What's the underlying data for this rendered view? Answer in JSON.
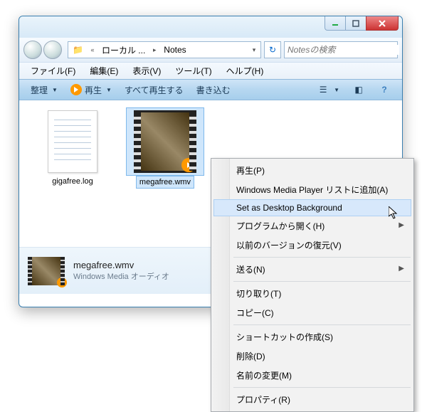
{
  "address": {
    "folder1": "ローカル ...",
    "folder2": "Notes"
  },
  "search": {
    "placeholder": "Notesの検索"
  },
  "menubar": {
    "file": "ファイル(F)",
    "edit": "編集(E)",
    "view": "表示(V)",
    "tools": "ツール(T)",
    "help": "ヘルプ(H)"
  },
  "toolbar": {
    "organize": "整理",
    "play": "再生",
    "playall": "すべて再生する",
    "burn": "書き込む"
  },
  "files": {
    "f0": {
      "name": "gigafree.log"
    },
    "f1": {
      "name": "megafree.wmv"
    }
  },
  "details": {
    "title": "megafree.wmv",
    "subtitle": "Windows Media オーディオ"
  },
  "context": {
    "play": "再生(P)",
    "addwmp": "Windows Media Player リストに追加(A)",
    "setbg": "Set as Desktop Background",
    "openwith": "プログラムから開く(H)",
    "restore": "以前のバージョンの復元(V)",
    "sendto": "送る(N)",
    "cut": "切り取り(T)",
    "copy": "コピー(C)",
    "shortcut": "ショートカットの作成(S)",
    "delete": "削除(D)",
    "rename": "名前の変更(M)",
    "props": "プロパティ(R)"
  }
}
